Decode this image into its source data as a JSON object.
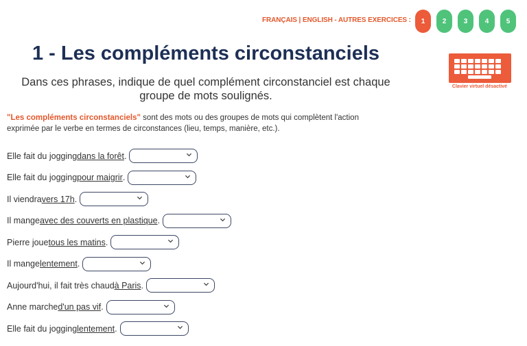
{
  "nav": {
    "francais": "FRANÇAIS",
    "sep": " | ",
    "english": "ENGLISH",
    "dash": " - ",
    "autres": "AUTRES EXERCICES :",
    "pages": [
      "1",
      "2",
      "3",
      "4",
      "5"
    ],
    "active_page": "1"
  },
  "header": {
    "title": "1 - Les compléments circonstanciels",
    "subtitle": "Dans ces phrases, indique de quel complément circonstanciel est chaque groupe de mots soulignés."
  },
  "keyboard": {
    "icon": "keyboard-icon",
    "label": "Clavier virtuel désactivé"
  },
  "intro": {
    "highlight": "\"Les compléments circonstanciels\"",
    "text": " sont des mots ou des groupes de mots qui complètent l'action exprimée par le verbe en termes de circonstances (lieu, temps, manière, etc.)."
  },
  "exercise": [
    {
      "before": "Elle fait du jogging ",
      "underlined": "dans la forêt",
      "after": ".",
      "selected": ""
    },
    {
      "before": "Elle fait du jogging ",
      "underlined": "pour maigrir",
      "after": ".",
      "selected": ""
    },
    {
      "before": "Il viendra ",
      "underlined": "vers 17h",
      "after": ".",
      "selected": ""
    },
    {
      "before": "Il mange ",
      "underlined": "avec des couverts en plastique",
      "after": ".",
      "selected": ""
    },
    {
      "before": "Pierre joue ",
      "underlined": "tous les matins",
      "after": ".",
      "selected": ""
    },
    {
      "before": "Il mange ",
      "underlined": "lentement",
      "after": ".",
      "selected": ""
    },
    {
      "before": "Aujourd'hui, il fait très chaud ",
      "underlined": "à Paris",
      "after": ".",
      "selected": ""
    },
    {
      "before": "Anne marche ",
      "underlined": "d'un pas vif",
      "after": ".",
      "selected": ""
    },
    {
      "before": "Elle fait du jogging ",
      "underlined": "lentement",
      "after": ".",
      "selected": ""
    }
  ],
  "colors": {
    "accent": "#ec5b3a",
    "pill_green": "#4fc37a",
    "title": "#1d2f55"
  }
}
